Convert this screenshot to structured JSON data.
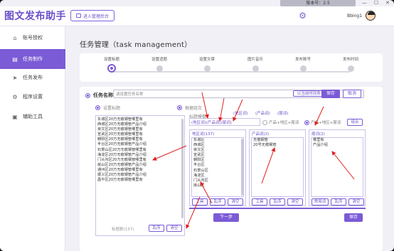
{
  "window": {
    "version_text": "版本号：2.5",
    "min_glyph": "—",
    "max_glyph": "☐",
    "close_glyph": "✕"
  },
  "header": {
    "brand": "图文发布助手",
    "admin_button": "进入管理后台",
    "username": "Bbing1"
  },
  "sidebar": {
    "items": [
      {
        "label": "账号授权",
        "icon": "home-icon",
        "glyph": "⌂"
      },
      {
        "label": "任务制作",
        "icon": "document-icon",
        "glyph": "▤"
      },
      {
        "label": "任务发布",
        "icon": "send-icon",
        "glyph": "➤"
      },
      {
        "label": "程序设置",
        "icon": "settings-icon",
        "glyph": "⚙"
      },
      {
        "label": "辅助工具",
        "icon": "toolbox-icon",
        "glyph": "▣"
      }
    ]
  },
  "main": {
    "page_title": "任务管理（task management）",
    "steps": [
      {
        "label": "设置标题",
        "active": true
      },
      {
        "label": "设置适题",
        "active": false
      },
      {
        "label": "设置文章",
        "active": false
      },
      {
        "label": "图片音乐",
        "active": false
      },
      {
        "label": "发布账号",
        "active": false
      },
      {
        "label": "发布时间",
        "active": false
      }
    ],
    "task": {
      "name_label": "任务名称",
      "name_placeholder": "请设置任务名称",
      "current_time_button": "以当前时间命名",
      "save_button": "保存",
      "cancel_button": "取消"
    },
    "title_source": {
      "set_title_radio": "设置标题",
      "combo_radio": "根据组合",
      "title_lines": [
        "东城区20万无痕钢管哪里有",
        "西城区20万无痕钢管产品介绍",
        "崇文区20万无痕钢管哪里有",
        "宣武区20万无痕钢管哪里有",
        "朝阳区20万无痕钢管哪里有",
        "丰台区20万无痕钢管产品介绍",
        "石景山区20万无痕钢管哪里有",
        "海淀区20万无痕钢管产品介绍",
        "门头沟区20万无痕钢管哪里有",
        "房山区20万无痕钢管产品介绍",
        "通州区20万无痕钢管哪里有",
        "顺义区20万无痕钢管产品介绍",
        "昌平区20万无痕钢管哪里有"
      ],
      "title_count": "标题数(137)",
      "shuffle_button": "乱序",
      "clear_button": "清空",
      "next_button": "下一步"
    },
    "combo": {
      "title_template_label": "标题模板",
      "tags": [
        "(地区词)",
        "(产品词)",
        "(尾词)"
      ],
      "tag_line": "(地区词)(产品词)(尾词)",
      "option_a": "产品+地区+尾词",
      "option_b": "产品+地区+尾词",
      "combine_button": "组合",
      "region_panel": {
        "head": "地区词(137)",
        "items": [
          "东城区",
          "西城区",
          "崇文区",
          "宣武区",
          "朝阳区",
          "丰台区",
          "石景山区",
          "海淀区",
          "门头沟区",
          "房山区"
        ],
        "tool_button": "工具",
        "shuffle_button": "乱序",
        "clear_button": "清空"
      },
      "product_panel": {
        "head": "产品词(2)",
        "items": [
          "无痕钢管",
          "20号无痕钢管"
        ],
        "tool_button": "工具",
        "shuffle_button": "乱序",
        "clear_button": "清空"
      },
      "tail_panel": {
        "head": "尾词(2)",
        "items": [
          "哪里有",
          "产品介绍"
        ],
        "common_button": "常用词",
        "shuffle_button": "乱序",
        "clear_button": "清空"
      },
      "save_button": "保存"
    }
  },
  "colors": {
    "accent": "#7b5bd6",
    "annotation_red": "#e02020"
  }
}
